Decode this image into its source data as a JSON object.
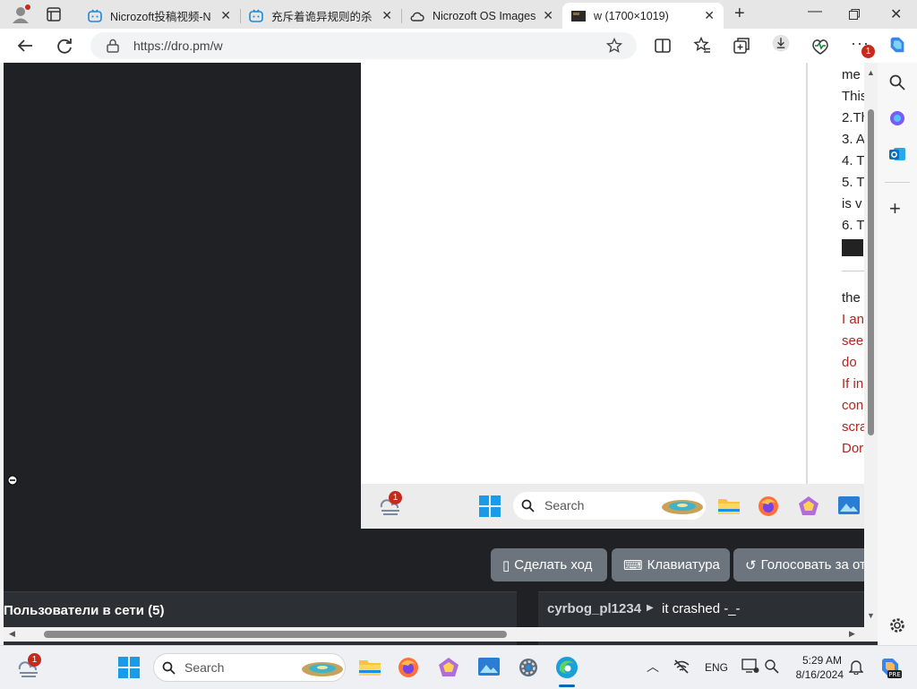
{
  "browser": {
    "tabs": [
      {
        "title": "Nicrozoft投稿视频-N",
        "active": false
      },
      {
        "title": "充斥着诡异规则的杀",
        "active": false
      },
      {
        "title": "Nicrozoft OS Images",
        "active": false
      },
      {
        "title": "w (1700×1019)",
        "active": true
      }
    ],
    "url": "https://dro.pm/w",
    "extension_badge": "1"
  },
  "vm": {
    "panel_lines": [
      {
        "text": "me",
        "color": "#222222"
      },
      {
        "text": "This",
        "color": "#222222"
      },
      {
        "text": "2.Th",
        "color": "#222222"
      },
      {
        "text": "3. A",
        "color": "#222222"
      },
      {
        "text": "4. T",
        "color": "#222222"
      },
      {
        "text": "5. T",
        "color": "#222222"
      },
      {
        "text": "is v",
        "color": "#222222"
      },
      {
        "text": "6. T",
        "color": "#222222"
      },
      {
        "text": "the",
        "color": "#222222"
      },
      {
        "text": "I an",
        "color": "#b3261e"
      },
      {
        "text": "see",
        "color": "#b3261e"
      },
      {
        "text": "do",
        "color": "#b3261e"
      },
      {
        "text": "If in",
        "color": "#b3261e"
      },
      {
        "text": "con",
        "color": "#b3261e"
      },
      {
        "text": "scra",
        "color": "#b3261e"
      },
      {
        "text": "Dor",
        "color": "#b3261e"
      }
    ],
    "taskbar": {
      "search_placeholder": "Search",
      "weather_badge": "1"
    }
  },
  "controls": {
    "make_move": "Сделать ход",
    "keyboard": "Клавиатура",
    "vote": "Голосовать за откат"
  },
  "users": {
    "header": "Пользователи в сети (5)"
  },
  "chat": {
    "username": "cyrbog_pl1234",
    "message": "it crashed -_-"
  },
  "taskbar": {
    "search_placeholder": "Search",
    "weather_badge": "1",
    "language": "ENG",
    "time": "5:29 AM",
    "date": "8/16/2024"
  },
  "colors": {
    "accent": "#0067c0",
    "button": "#6c757d",
    "content_bg": "#1f2124"
  }
}
